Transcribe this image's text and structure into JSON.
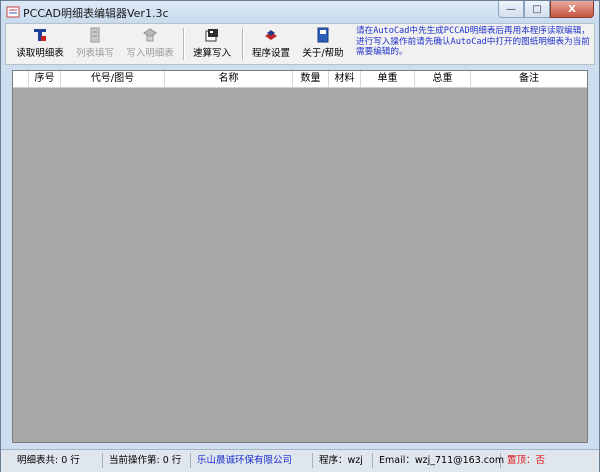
{
  "window": {
    "title": "PCCAD明细表编辑器Ver1.3c",
    "controls": {
      "minimize": "—",
      "maximize": "□",
      "close": "X"
    }
  },
  "toolbar": {
    "buttons": [
      {
        "label": "读取明细表",
        "icon": "cad-read-icon",
        "enabled": true
      },
      {
        "label": "列表填写",
        "icon": "list-fill-icon",
        "enabled": false
      },
      {
        "label": "写入明细表",
        "icon": "write-table-icon",
        "enabled": false
      },
      {
        "label": "速算写入",
        "icon": "quick-calc-icon",
        "enabled": true
      },
      {
        "label": "程序设置",
        "icon": "settings-icon",
        "enabled": true
      },
      {
        "label": "关于/帮助",
        "icon": "help-book-icon",
        "enabled": true
      }
    ],
    "notice": "请在AutoCad中先生成PCCAD明细表后再用本程序读取编辑，进行写入操作前请先确认AutoCad中打开的图纸明细表为当前需要编辑的。"
  },
  "table": {
    "columns": [
      "序号",
      "代号/图号",
      "名称",
      "数量",
      "材料",
      "单重",
      "总重",
      "备注"
    ],
    "rows": []
  },
  "statusbar": {
    "total_rows": "明细表共:  0  行",
    "current_op": "当前操作第:  0  行",
    "company": "乐山晨诚环保有限公司",
    "author": "程序：wzj",
    "email": "Email：wzj_711@163.com",
    "topmost": "置顶：否"
  },
  "colors": {
    "accent_blue": "#1c2fcf",
    "status_red": "#e01010",
    "grid_gray": "#a9a9a9"
  }
}
